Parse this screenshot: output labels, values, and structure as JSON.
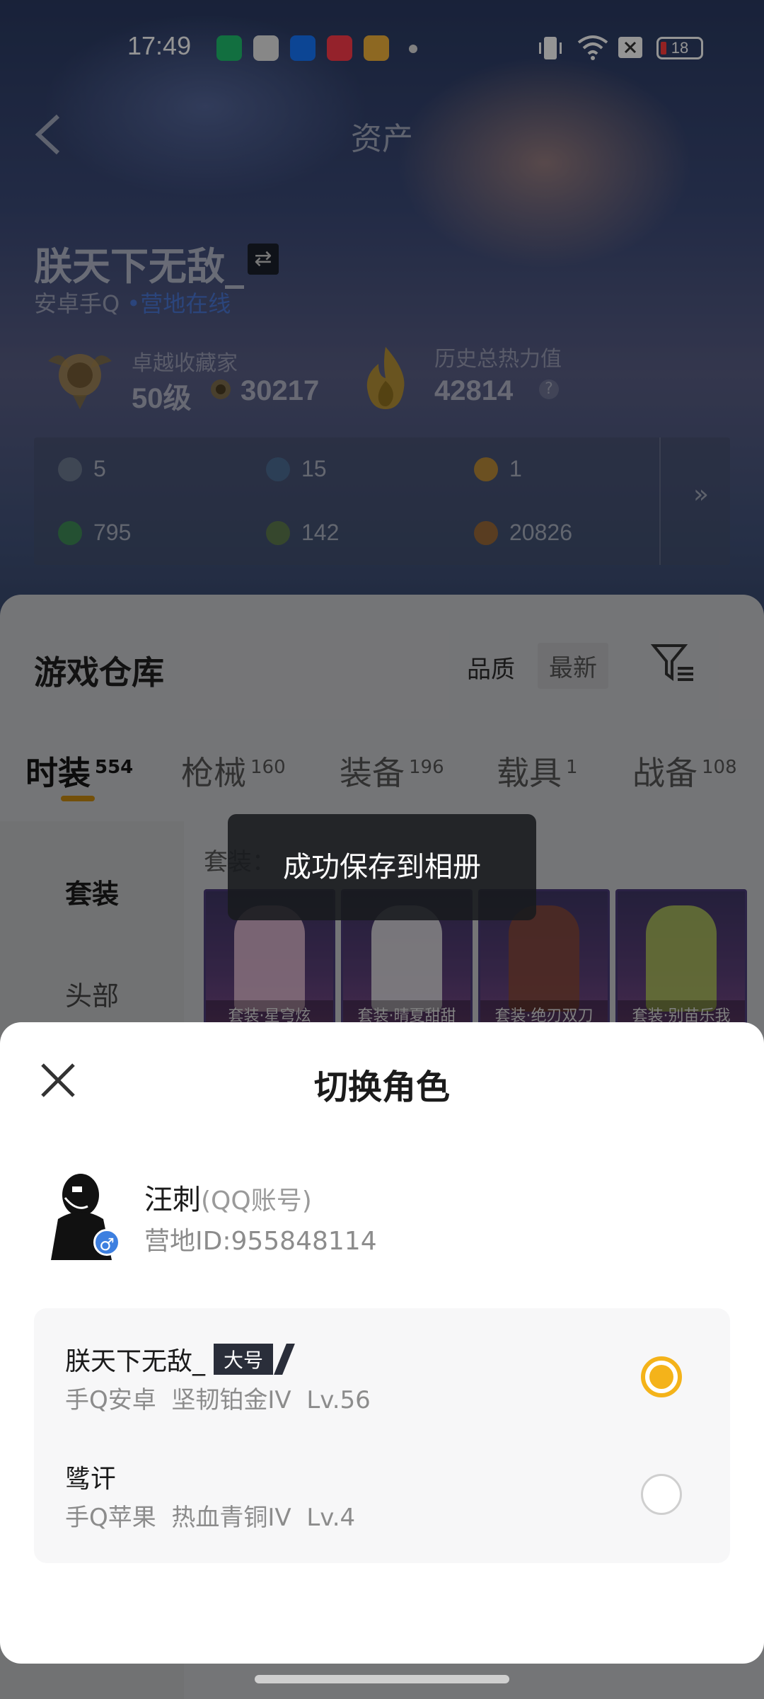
{
  "status_bar": {
    "time": "17:49",
    "battery": "18",
    "app_icons": [
      {
        "name": "battery-app-icon",
        "color": "#1fbf6f"
      },
      {
        "name": "shield-app-icon",
        "color": "#e9e9e9"
      },
      {
        "name": "alipay-app-icon",
        "color": "#1677ff"
      },
      {
        "name": "music-app-icon",
        "color": "#ff3b4a"
      },
      {
        "name": "game-app-icon",
        "color": "#f3b43b"
      }
    ]
  },
  "header": {
    "title": "资产"
  },
  "profile": {
    "name": "朕天下无敌_",
    "platform": "安卓手Q",
    "online_status": "营地在线",
    "collector_label": "卓越收藏家",
    "level": "50级",
    "coins": "30217",
    "power_label": "历史总热力值",
    "power_value": "42814"
  },
  "resources": [
    {
      "icon": "card-icon",
      "value": "5",
      "color": "#6d7a92"
    },
    {
      "icon": "blue-coin-icon",
      "value": "15",
      "color": "#4d6d94"
    },
    {
      "icon": "gold-coin-icon",
      "value": "1",
      "color": "#b88a3a"
    },
    {
      "icon": "green-card-icon",
      "value": "795",
      "color": "#3e8a57"
    },
    {
      "icon": "green-coin-icon",
      "value": "142",
      "color": "#5e7a4f"
    },
    {
      "icon": "bronze-coin-icon",
      "value": "20826",
      "color": "#9a6a3a"
    }
  ],
  "warehouse": {
    "title": "游戏仓库",
    "sort_quality": "品质",
    "sort_new": "最新",
    "tabs": [
      {
        "label": "时装",
        "count": "554"
      },
      {
        "label": "枪械",
        "count": "160"
      },
      {
        "label": "装备",
        "count": "196"
      },
      {
        "label": "载具",
        "count": "1"
      },
      {
        "label": "战备",
        "count": "108"
      }
    ],
    "side_items": [
      "套装",
      "头部"
    ],
    "sub_header": "套装：",
    "items": [
      {
        "caption": "套装·星穹炫",
        "color": "#e8c1d6"
      },
      {
        "caption": "套装·晴夏甜甜",
        "color": "#e6e6e6"
      },
      {
        "caption": "套装·绝刃双刀",
        "color": "#8a4a3a"
      },
      {
        "caption": "套装·别苗乐我",
        "color": "#b4c95a"
      }
    ]
  },
  "toast": {
    "message": "成功保存到相册"
  },
  "sheet": {
    "title": "切换角色",
    "account_name": "汪刺",
    "account_type": "(QQ账号)",
    "account_id": "营地ID:955848114",
    "roles": [
      {
        "name": "朕天下无敌_",
        "tag": "大号",
        "platform": "手Q安卓",
        "rank": "坚韧铂金IV",
        "level": "Lv.56",
        "selected": true
      },
      {
        "name": "骘讦",
        "tag": "",
        "platform": "手Q苹果",
        "rank": "热血青铜IV",
        "level": "Lv.4",
        "selected": false
      }
    ]
  }
}
